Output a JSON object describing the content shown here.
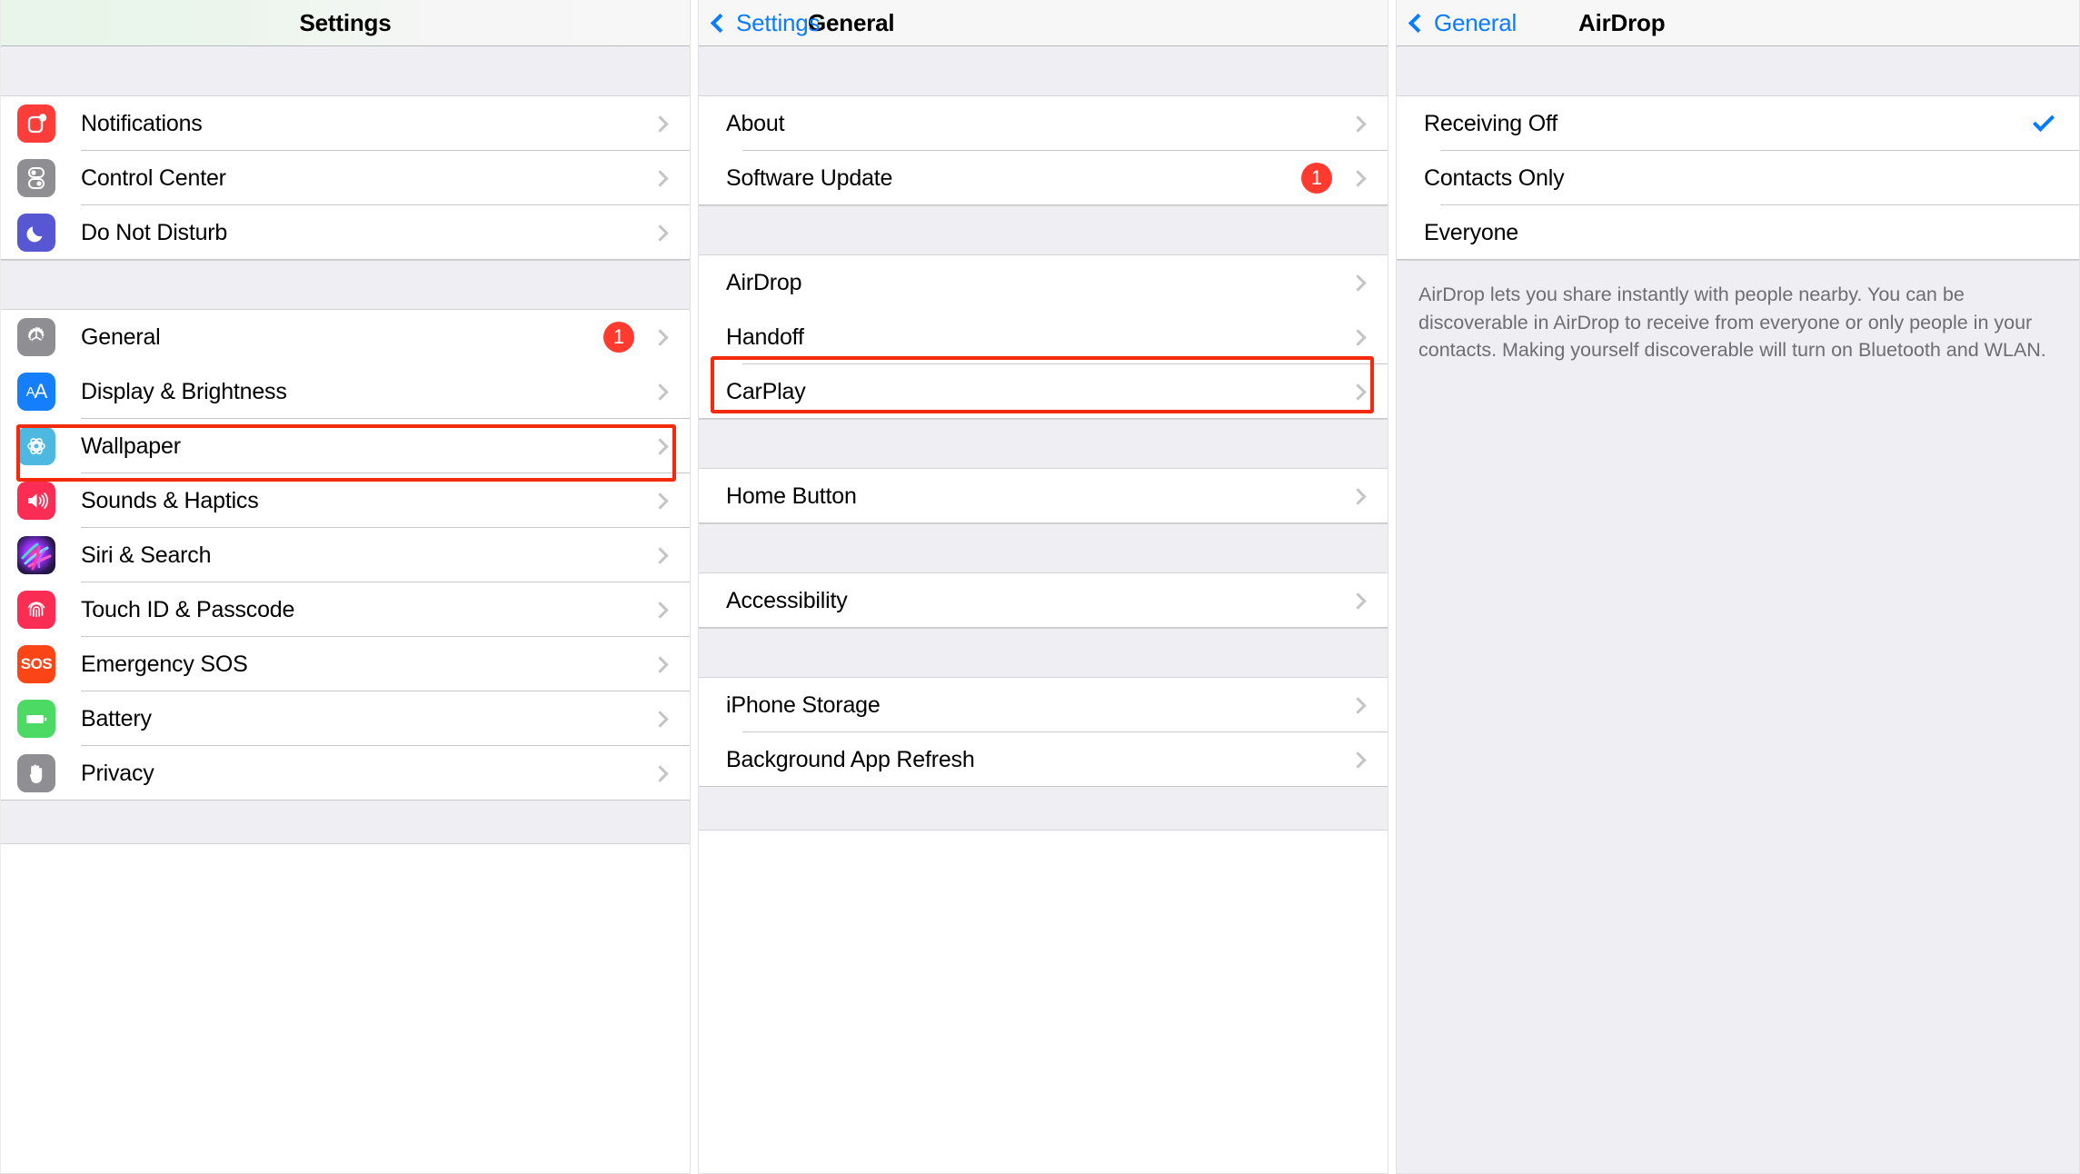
{
  "panels": {
    "settings": {
      "title": "Settings",
      "groups": [
        {
          "rows": [
            {
              "label": "Notifications",
              "icon": "notifications-icon",
              "accessory": "chevron"
            },
            {
              "label": "Control Center",
              "icon": "control-center-icon",
              "accessory": "chevron"
            },
            {
              "label": "Do Not Disturb",
              "icon": "do-not-disturb-icon",
              "accessory": "chevron"
            }
          ]
        },
        {
          "rows": [
            {
              "label": "General",
              "icon": "gear-icon",
              "accessory": "badge-chevron",
              "badge": "1",
              "highlighted": true
            },
            {
              "label": "Display & Brightness",
              "icon": "display-brightness-icon",
              "accessory": "chevron"
            },
            {
              "label": "Wallpaper",
              "icon": "wallpaper-icon",
              "accessory": "chevron"
            },
            {
              "label": "Sounds & Haptics",
              "icon": "speaker-icon",
              "accessory": "chevron"
            },
            {
              "label": "Siri & Search",
              "icon": "siri-icon",
              "accessory": "chevron"
            },
            {
              "label": "Touch ID & Passcode",
              "icon": "fingerprint-icon",
              "accessory": "chevron"
            },
            {
              "label": "Emergency SOS",
              "icon": "sos-icon",
              "accessory": "chevron"
            },
            {
              "label": "Battery",
              "icon": "battery-icon",
              "accessory": "chevron"
            },
            {
              "label": "Privacy",
              "icon": "hand-icon",
              "accessory": "chevron"
            }
          ]
        }
      ]
    },
    "general": {
      "title": "General",
      "back_label": "Settings",
      "groups": [
        {
          "rows": [
            {
              "label": "About",
              "accessory": "chevron"
            },
            {
              "label": "Software Update",
              "accessory": "badge-chevron",
              "badge": "1"
            }
          ]
        },
        {
          "rows": [
            {
              "label": "AirDrop",
              "accessory": "chevron",
              "highlighted": true
            },
            {
              "label": "Handoff",
              "accessory": "chevron"
            },
            {
              "label": "CarPlay",
              "accessory": "chevron"
            }
          ]
        },
        {
          "rows": [
            {
              "label": "Home Button",
              "accessory": "chevron"
            }
          ]
        },
        {
          "rows": [
            {
              "label": "Accessibility",
              "accessory": "chevron"
            }
          ]
        },
        {
          "rows": [
            {
              "label": "iPhone Storage",
              "accessory": "chevron"
            },
            {
              "label": "Background App Refresh",
              "accessory": "chevron"
            }
          ]
        }
      ]
    },
    "airdrop": {
      "title": "AirDrop",
      "back_label": "General",
      "options": [
        {
          "label": "Receiving Off",
          "selected": true
        },
        {
          "label": "Contacts Only",
          "selected": false
        },
        {
          "label": "Everyone",
          "selected": false
        }
      ],
      "footer": "AirDrop lets you share instantly with people nearby. You can be discoverable in AirDrop to receive from everyone or only people in your contacts. Making yourself discoverable will turn on Bluetooth and WLAN."
    }
  },
  "colors": {
    "highlight": "#f42a0d",
    "badge": "#ff3b30",
    "link": "#0a7cff",
    "check": "#007aff",
    "group_bg": "#eeeef3",
    "separator": "#c8c7cc"
  }
}
